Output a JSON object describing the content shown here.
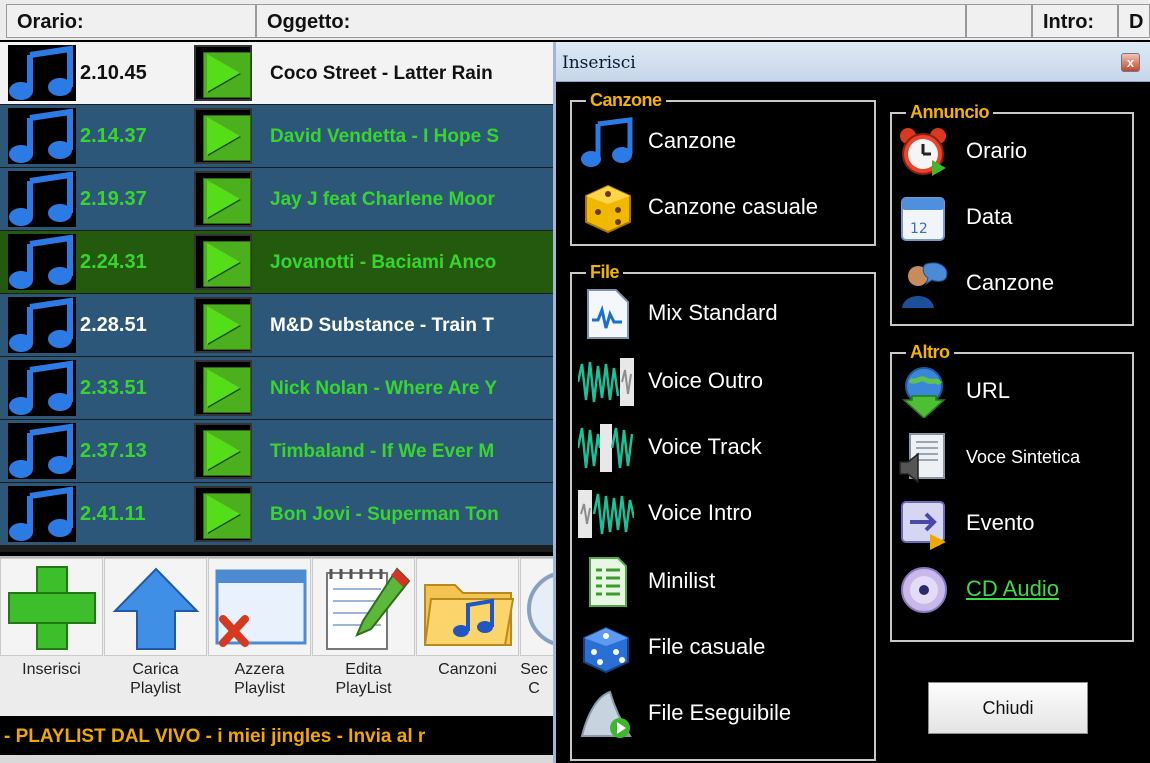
{
  "header": {
    "col_time": "Orario:",
    "col_object": "Oggetto:",
    "col_intro": "Intro:",
    "col_d": "D"
  },
  "playlist": {
    "rows": [
      {
        "time": "2.10.45",
        "title": "Coco Street - Latter Rain",
        "bg": "#f3f3f3",
        "fg": "#111111"
      },
      {
        "time": "2.14.37",
        "title": "David Vendetta - I Hope S",
        "bg": "#2d5778",
        "fg": "#39d52e"
      },
      {
        "time": "2.19.37",
        "title": "Jay J feat Charlene Moor",
        "bg": "#2d5778",
        "fg": "#39d52e"
      },
      {
        "time": "2.24.31",
        "title": "Jovanotti - Baciami Anco",
        "bg": "#245a0e",
        "fg": "#39d52e"
      },
      {
        "time": "2.28.51",
        "title": "M&D Substance - Train T",
        "bg": "#2d5778",
        "fg": "#ffffff"
      },
      {
        "time": "2.33.51",
        "title": "Nick Nolan - Where Are Y",
        "bg": "#2d5778",
        "fg": "#39d52e"
      },
      {
        "time": "2.37.13",
        "title": "Timbaland - If We Ever M",
        "bg": "#2d5778",
        "fg": "#39d52e"
      },
      {
        "time": "2.41.11",
        "title": "Bon Jovi - Superman Ton",
        "bg": "#2d5778",
        "fg": "#39d52e"
      }
    ]
  },
  "toolbar": {
    "buttons": [
      {
        "label": "Inserisci",
        "icon": "plus-icon"
      },
      {
        "label": "Carica\nPlaylist",
        "icon": "arrow-up-icon"
      },
      {
        "label": "Azzera\nPlaylist",
        "icon": "window-delete-icon"
      },
      {
        "label": "Edita\nPlayList",
        "icon": "notepad-pencil-icon"
      },
      {
        "label": "Canzoni",
        "icon": "music-folder-icon"
      },
      {
        "label": "Sec\nC",
        "icon": "clock-icon"
      }
    ],
    "marquee": "- PLAYLIST DAL VIVO - i miei jingles - Invia al r"
  },
  "dialog": {
    "title": "Inserisci",
    "close": "x",
    "groups": {
      "canzone": {
        "title": "Canzone",
        "items": [
          {
            "label": "Canzone",
            "icon": "music-note-icon"
          },
          {
            "label": "Canzone casuale",
            "icon": "dice-icon"
          }
        ]
      },
      "file": {
        "title": "File",
        "items": [
          {
            "label": "Mix Standard",
            "icon": "audio-file-icon"
          },
          {
            "label": "Voice Outro",
            "icon": "waveform-outro-icon"
          },
          {
            "label": "Voice Track",
            "icon": "waveform-track-icon"
          },
          {
            "label": "Voice Intro",
            "icon": "waveform-intro-icon"
          },
          {
            "label": "Minilist",
            "icon": "list-document-icon"
          },
          {
            "label": "File casuale",
            "icon": "blue-dice-icon"
          },
          {
            "label": "File Eseguibile",
            "icon": "executable-icon"
          }
        ]
      },
      "annuncio": {
        "title": "Annuncio",
        "items": [
          {
            "label": "Orario",
            "icon": "alarm-clock-icon"
          },
          {
            "label": "Data",
            "icon": "calendar-icon"
          },
          {
            "label": "Canzone",
            "icon": "speaker-person-icon"
          }
        ]
      },
      "altro": {
        "title": "Altro",
        "items": [
          {
            "label": "URL",
            "icon": "globe-download-icon"
          },
          {
            "label": "Voce Sintetica",
            "icon": "speaker-document-icon"
          },
          {
            "label": "Evento",
            "icon": "event-arrow-icon"
          },
          {
            "label": "CD Audio",
            "icon": "cd-icon"
          }
        ]
      }
    },
    "close_button": "Chiudi"
  },
  "colors": {
    "group_title": "#f2b20a",
    "accent_green": "#39d52e",
    "row_blue": "#2d5778",
    "row_selected": "#245a0e"
  }
}
